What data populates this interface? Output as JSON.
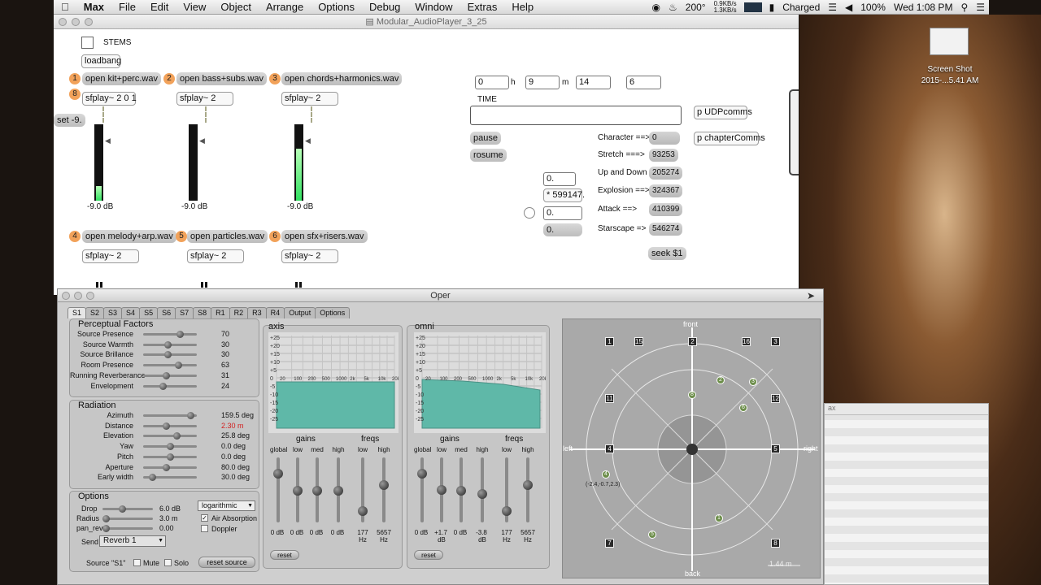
{
  "menubar": {
    "apple": "",
    "items": [
      "Max",
      "File",
      "Edit",
      "View",
      "Object",
      "Arrange",
      "Options",
      "Debug",
      "Window",
      "Extras",
      "Help"
    ],
    "status": {
      "temp": "200°",
      "net_up": "0.9KB/s",
      "net_down": "1.3KB/s",
      "battery_state": "Charged",
      "battery_pct": "100%",
      "clock": "Wed 1:08 PM"
    }
  },
  "desktop": {
    "file_label_1": "Screen Shot",
    "file_label_2": "2015-...5.41 AM",
    "window_label": "ax"
  },
  "patcher": {
    "title": "Modular_AudioPlayer_3_25",
    "toggle_label": "STEMS",
    "loadbang": "loadbang",
    "set_msg": "set -9.",
    "opens": [
      {
        "num": "1",
        "label": "open kit+perc.wav"
      },
      {
        "num": "2",
        "label": "open bass+subs.wav"
      },
      {
        "num": "3",
        "label": "open chords+harmonics.wav"
      },
      {
        "num": "4",
        "label": "open melody+arp.wav"
      },
      {
        "num": "5",
        "label": "open particles.wav"
      },
      {
        "num": "6",
        "label": "open sfx+risers.wav"
      }
    ],
    "sfplay_main": "sfplay~ 2 0 1",
    "sfplay": "sfplay~ 2",
    "badge8": "8",
    "meters": [
      {
        "db": "-9.0 dB",
        "level": 0.2
      },
      {
        "db": "-9.0 dB",
        "level": 0
      },
      {
        "db": "-9.0 dB",
        "level": 0.7
      }
    ],
    "time": {
      "h": "0",
      "h_label": "h",
      "m": "9",
      "m_label": "m",
      "s": "14",
      "ms": "6",
      "label": "TIME"
    },
    "pause": "pause",
    "resume": "rosume",
    "num_a": "0.",
    "mult": "* 599147.",
    "num_b": "0.",
    "num_c": "0.",
    "cues": [
      {
        "label": "Character ==>",
        "value": "0"
      },
      {
        "label": "Stretch  ===>",
        "value": "93253"
      },
      {
        "label": "Up and Down",
        "value": "205274"
      },
      {
        "label": "Explosion ==>",
        "value": "324367"
      },
      {
        "label": "Attack     ==>",
        "value": "410399"
      },
      {
        "label": "Starscape  =>",
        "value": "546274"
      }
    ],
    "seek": "seek $1",
    "udp": "p UDPcomms",
    "chapter": "p chapterComms"
  },
  "oper": {
    "title": "Oper",
    "tabs": [
      "S1",
      "S2",
      "S3",
      "S4",
      "S5",
      "S6",
      "S7",
      "S8",
      "R1",
      "R2",
      "R3",
      "R4",
      "Output",
      "Options"
    ],
    "perceptual": {
      "title": "Perceptual Factors",
      "rows": [
        {
          "label": "Source Presence",
          "value": "70",
          "pos": 0.7
        },
        {
          "label": "Source Warmth",
          "value": "30",
          "pos": 0.45
        },
        {
          "label": "Source Brillance",
          "value": "30",
          "pos": 0.45
        },
        {
          "label": "Room Presence",
          "value": "63",
          "pos": 0.68
        },
        {
          "label": "Running Reverberance",
          "value": "31",
          "pos": 0.42
        },
        {
          "label": "Envelopment",
          "value": "24",
          "pos": 0.35
        }
      ]
    },
    "radiation": {
      "title": "Radiation",
      "rows": [
        {
          "label": "Azimuth",
          "value": "159.5 deg",
          "pos": 0.93
        },
        {
          "label": "Distance",
          "value": "2.30 m",
          "pos": 0.42
        },
        {
          "label": "Elevation",
          "value": "25.8 deg",
          "pos": 0.64
        },
        {
          "label": "Yaw",
          "value": "0.0 deg",
          "pos": 0.5
        },
        {
          "label": "Pitch",
          "value": "0.0 deg",
          "pos": 0.5
        },
        {
          "label": "Aperture",
          "value": "80.0 deg",
          "pos": 0.42
        },
        {
          "label": "Early width",
          "value": "30.0 deg",
          "pos": 0.12
        }
      ]
    },
    "options": {
      "title": "Options",
      "drop_label": "Drop",
      "drop_value": "6.0 dB",
      "radius_label": "Radius",
      "radius_value": "3.0 m",
      "panrev_label": "pan_rev",
      "panrev_value": "0.00",
      "mode": "logarithmic",
      "air": "Air Absorption",
      "doppler": "Doppler",
      "send_label": "Send",
      "send_value": "Reverb 1",
      "source_label": "Source \"S1\"",
      "mute": "Mute",
      "solo": "Solo",
      "reset_source": "reset source"
    },
    "axis": {
      "title": "axis",
      "gains": "gains",
      "freqs": "freqs",
      "gain_labels": [
        "global",
        "low",
        "med",
        "high"
      ],
      "gain_values": [
        "0 dB",
        "0 dB",
        "0 dB",
        "0 dB"
      ],
      "freq_labels": [
        "low",
        "high"
      ],
      "freq_values": [
        "177",
        "5657"
      ],
      "freq_unit": "Hz",
      "reset": "reset"
    },
    "omni": {
      "title": "omni",
      "gains": "gains",
      "freqs": "freqs",
      "gain_labels": [
        "global",
        "low",
        "med",
        "high"
      ],
      "gain_values": [
        "0 dB",
        "+1.7",
        "0 dB",
        "-3.8"
      ],
      "gain_units": [
        "",
        "dB",
        "",
        "dB"
      ],
      "freq_labels": [
        "low",
        "high"
      ],
      "freq_values": [
        "177",
        "5657"
      ],
      "freq_unit": "Hz",
      "reset": "reset"
    },
    "eq_ticks": [
      "+25",
      "+20",
      "+15",
      "+10",
      "+5",
      "0",
      "-5",
      "-10",
      "-15",
      "-20",
      "-25"
    ],
    "eq_freq_ticks": [
      "20",
      "100",
      "200",
      "500",
      "1000",
      "2k",
      "5k",
      "10k",
      "20k"
    ],
    "space": {
      "front": "front",
      "back": "back",
      "left": "left",
      "right": "right",
      "scale": "1.44 m",
      "coord": "(-2.4,-0.7,2.3)",
      "speakers": [
        "1",
        "15",
        "2",
        "16",
        "3",
        "11",
        "12",
        "4",
        "5",
        "7",
        "8"
      ],
      "sources": [
        "8",
        "2",
        "3",
        "6",
        "4",
        "1",
        "5"
      ]
    },
    "colors": {
      "eq_fill": "#5fb8a8",
      "distance_red": "#d22020",
      "source_green": "#6d8e4b"
    }
  }
}
